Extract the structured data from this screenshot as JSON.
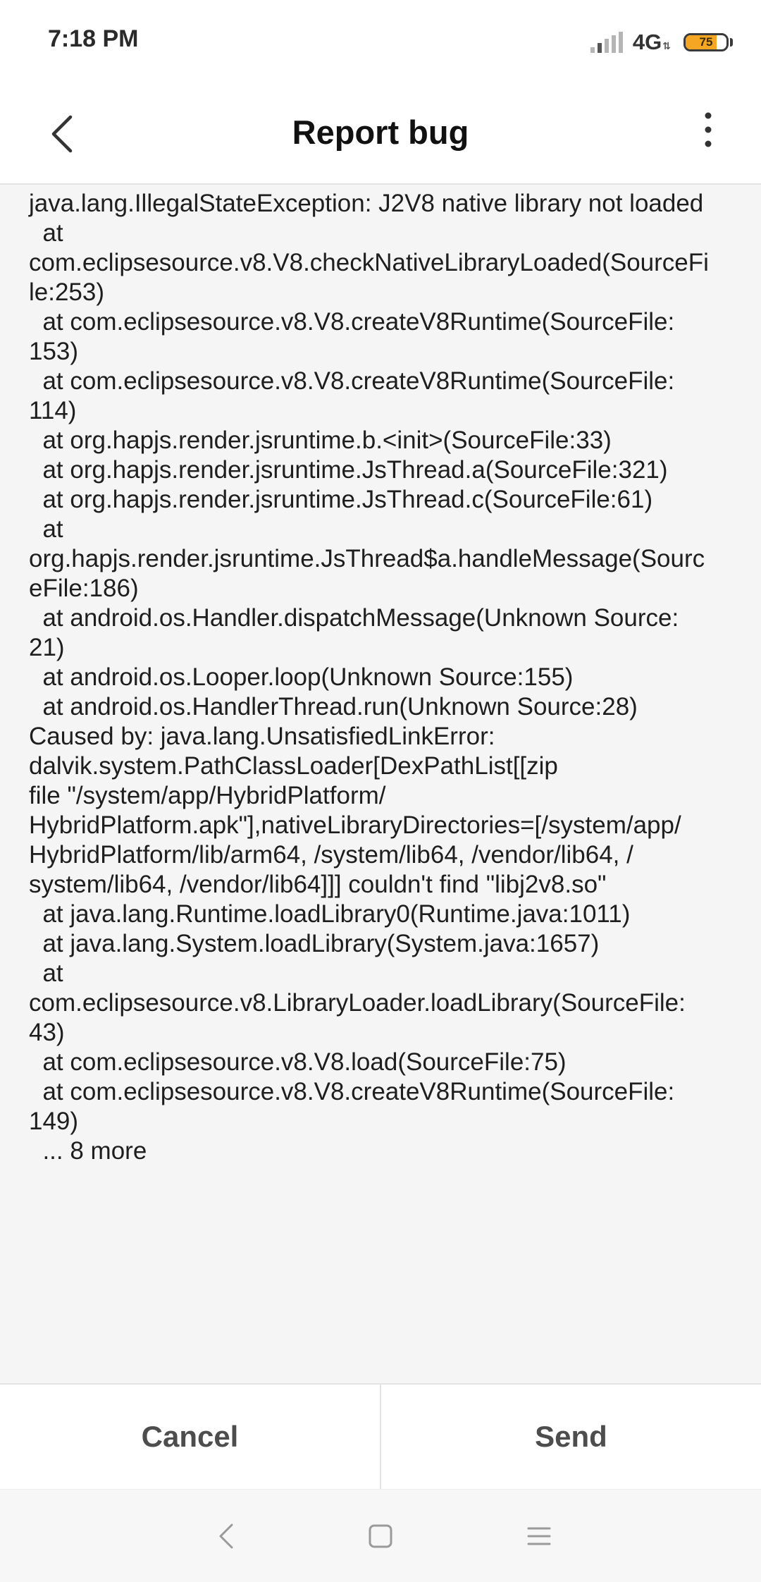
{
  "status_bar": {
    "time": "7:18 PM",
    "network": "4G",
    "battery_level": "75",
    "battery_fraction": 0.75,
    "icons": [
      "signal-icon",
      "network-arrows-icon",
      "battery-icon"
    ]
  },
  "header": {
    "title": "Report bug",
    "back_icon": "chevron-left-icon",
    "more_icon": "more-vertical-icon"
  },
  "report": {
    "text": "java.lang.IllegalStateException: J2V8 native library not loaded\n  at\ncom.eclipsesource.v8.V8.checkNativeLibraryLoaded(SourceFi\nle:253)\n  at com.eclipsesource.v8.V8.createV8Runtime(SourceFile:\n153)\n  at com.eclipsesource.v8.V8.createV8Runtime(SourceFile:\n114)\n  at org.hapjs.render.jsruntime.b.<init>(SourceFile:33)\n  at org.hapjs.render.jsruntime.JsThread.a(SourceFile:321)\n  at org.hapjs.render.jsruntime.JsThread.c(SourceFile:61)\n  at\norg.hapjs.render.jsruntime.JsThread$a.handleMessage(Sourc\neFile:186)\n  at android.os.Handler.dispatchMessage(Unknown Source:\n21)\n  at android.os.Looper.loop(Unknown Source:155)\n  at android.os.HandlerThread.run(Unknown Source:28)\nCaused by: java.lang.UnsatisfiedLinkError:\ndalvik.system.PathClassLoader[DexPathList[[zip\nfile \"/system/app/HybridPlatform/\nHybridPlatform.apk\"],nativeLibraryDirectories=[/system/app/\nHybridPlatform/lib/arm64, /system/lib64, /vendor/lib64, /\nsystem/lib64, /vendor/lib64]]] couldn't find \"libj2v8.so\"\n  at java.lang.Runtime.loadLibrary0(Runtime.java:1011)\n  at java.lang.System.loadLibrary(System.java:1657)\n  at\ncom.eclipsesource.v8.LibraryLoader.loadLibrary(SourceFile:\n43)\n  at com.eclipsesource.v8.V8.load(SourceFile:75)\n  at com.eclipsesource.v8.V8.createV8Runtime(SourceFile:\n149)\n  ... 8 more"
  },
  "actions": {
    "cancel_label": "Cancel",
    "send_label": "Send"
  },
  "nav_bar": {
    "icons": [
      "nav-back-icon",
      "nav-home-icon",
      "nav-recents-icon"
    ]
  },
  "colors": {
    "background": "#ffffff",
    "content_background": "#f5f5f5",
    "text": "#1e1e1e",
    "button_text": "#4d4d4d",
    "divider": "#e3e3e3",
    "battery_fill": "#f5a623"
  }
}
